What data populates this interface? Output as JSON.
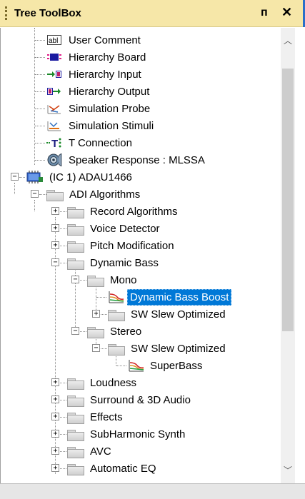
{
  "panel": {
    "title": "Tree ToolBox",
    "pin_glyph": "ᴨ",
    "close_glyph": "✕"
  },
  "scroll": {
    "up_glyph": "︿",
    "down_glyph": "﹀"
  },
  "tree": {
    "user_comment": "User Comment",
    "hierarchy_board": "Hierarchy Board",
    "hierarchy_input": "Hierarchy Input",
    "hierarchy_output": "Hierarchy Output",
    "simulation_probe": "Simulation Probe",
    "simulation_stimuli": "Simulation Stimuli",
    "t_connection": "T Connection",
    "speaker_response": "Speaker Response : MLSSA",
    "ic": "(IC 1) ADAU1466",
    "adi_algorithms": "ADI Algorithms",
    "record_algorithms": "Record Algorithms",
    "voice_detector": "Voice Detector",
    "pitch_modification": "Pitch Modification",
    "dynamic_bass": "Dynamic Bass",
    "mono": "Mono",
    "dynamic_bass_boost": "Dynamic Bass Boost",
    "sw_slew_optimized_1": "SW Slew Optimized",
    "stereo": "Stereo",
    "sw_slew_optimized_2": "SW Slew Optimized",
    "superbass": "SuperBass",
    "loudness": "Loudness",
    "surround": "Surround & 3D Audio",
    "effects": "Effects",
    "subharmonic": "SubHarmonic Synth",
    "avc": "AVC",
    "automatic_eq": "Automatic EQ",
    "expand_glyph": "+",
    "collapse_glyph": "−",
    "abl_text": "abl",
    "t_text": "T"
  },
  "colors": {
    "title_bg": "#f6e7a8",
    "selection": "#0078d7"
  }
}
